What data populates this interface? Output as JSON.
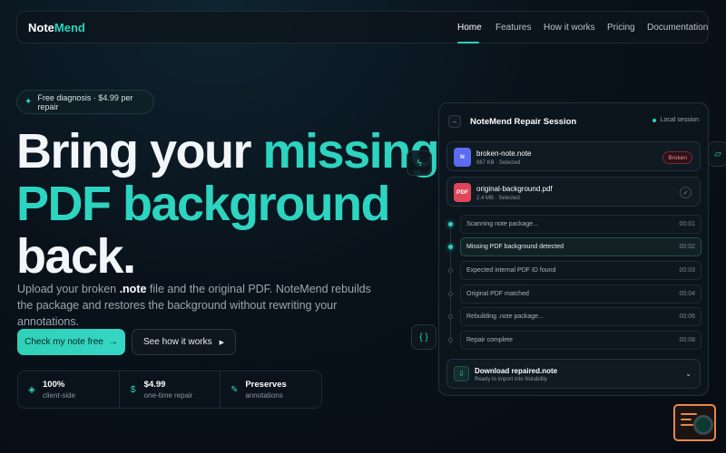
{
  "nav": {
    "logo_a": "Note",
    "logo_b": "Mend",
    "links": [
      "Home",
      "Features",
      "How it works",
      "Pricing",
      "Documentation"
    ]
  },
  "hero": {
    "badge": "Free diagnosis · $4.99 per repair",
    "headline": {
      "l1a": "Bring your ",
      "l1b": "missing",
      "l2": "PDF background",
      "l3": "back."
    },
    "sub_a": "Upload your broken ",
    "sub_bold": ".note",
    "sub_b": " file and the original PDF. NoteMend rebuilds the package and restores the background without rewriting your annotations.",
    "cta_primary": "Check my note free",
    "cta_secondary": "See how it works"
  },
  "stats": [
    {
      "value": "100%",
      "label": "client-side",
      "icon": "shield-icon"
    },
    {
      "value": "$4.99",
      "label": "one-time repair",
      "icon": "dollar-icon"
    },
    {
      "value": "Preserves",
      "label": "annotations",
      "icon": "pen-icon"
    }
  ],
  "panel": {
    "title": "NoteMend Repair Session",
    "local": "Local session",
    "files": [
      {
        "icon_label": "N",
        "name": "broken-note.note",
        "meta": "967 KB · Selected",
        "tag": "Broken",
        "color": "#5b6cf0"
      },
      {
        "icon_label": "PDF",
        "name": "original-background.pdf",
        "meta": "2.4 MB · Selected",
        "color": "#e0455a"
      }
    ],
    "steps": [
      {
        "label": "Scanning note package...",
        "time": "00:01"
      },
      {
        "label": "Missing PDF background detected",
        "time": "00:02"
      },
      {
        "label": "Expected internal PDF ID found",
        "time": "00:03"
      },
      {
        "label": "Original PDF matched",
        "time": "00:04"
      },
      {
        "label": "Rebuilding .note package...",
        "time": "00:06"
      },
      {
        "label": "Repair complete",
        "time": "00:08"
      }
    ],
    "download": {
      "title": "Download repaired.note",
      "sub": "Ready to import into Notability"
    }
  },
  "colors": {
    "accent": "#2dd4bf",
    "danger": "#f08a96"
  }
}
